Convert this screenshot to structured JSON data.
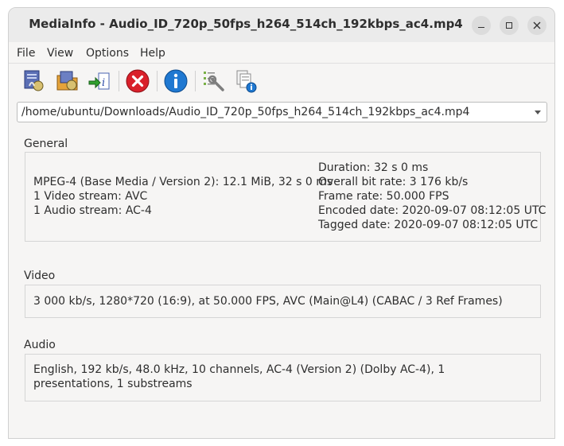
{
  "window": {
    "title": "MediaInfo - Audio_ID_720p_50fps_h264_514ch_192kbps_ac4.mp4",
    "controls": [
      "minimize-icon",
      "maximize-icon",
      "close-icon"
    ]
  },
  "menubar": {
    "items": [
      {
        "label": "File"
      },
      {
        "label": "View"
      },
      {
        "label": "Options"
      },
      {
        "label": "Help"
      }
    ]
  },
  "toolbar": {
    "buttons": [
      {
        "icon": "open-file-icon"
      },
      {
        "icon": "open-folder-icon"
      },
      {
        "icon": "export-icon"
      },
      {
        "icon": "close-file-icon"
      },
      {
        "icon": "info-icon"
      },
      {
        "icon": "preferences-icon"
      },
      {
        "icon": "about-icon"
      }
    ]
  },
  "file_path": "/home/ubuntu/Downloads/Audio_ID_720p_50fps_h264_514ch_192kbps_ac4.mp4",
  "general": {
    "label": "General",
    "left": [
      "MPEG-4 (Base Media / Version 2): 12.1 MiB, 32 s 0 ms",
      "1 Video stream: AVC",
      "1 Audio stream: AC-4"
    ],
    "right": [
      "Duration: 32 s 0 ms",
      "Overall bit rate: 3 176 kb/s",
      "Frame rate: 50.000 FPS",
      "Encoded date: 2020-09-07 08:12:05 UTC",
      "Tagged date: 2020-09-07 08:12:05 UTC"
    ]
  },
  "video": {
    "label": "Video",
    "text": "3 000 kb/s, 1280*720 (16:9), at 50.000 FPS, AVC (Main@L4) (CABAC / 3 Ref Frames)"
  },
  "audio": {
    "label": "Audio",
    "text": "English, 192 kb/s, 48.0 kHz, 10 channels, AC-4 (Version 2) (Dolby AC-4), 1 presentations, 1 substreams"
  },
  "colors": {
    "error_red": "#d9202a",
    "info_blue": "#1f78d1"
  }
}
